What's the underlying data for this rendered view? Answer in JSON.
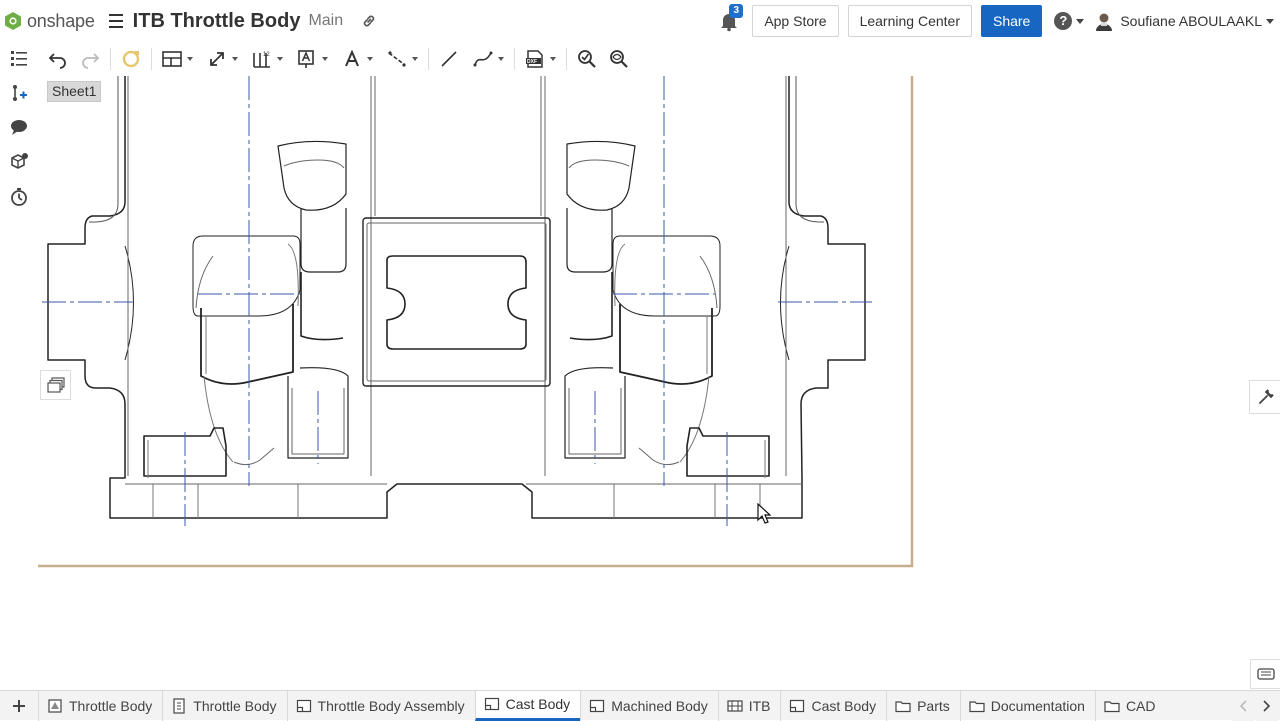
{
  "app": {
    "name": "onshape"
  },
  "document": {
    "title": "ITB Throttle Body",
    "branch": "Main"
  },
  "notifications": {
    "count": "3"
  },
  "header": {
    "app_store": "App Store",
    "learning_center": "Learning Center",
    "share": "Share",
    "user_name": "Soufiane ABOULAAKL"
  },
  "sheet": {
    "name": "Sheet1"
  },
  "colors": {
    "accent": "#1767c2",
    "sheet_border": "#c8ad8a",
    "centerline": "#3a5aa8"
  },
  "toolbar": {
    "icons": [
      "undo-icon",
      "redo-icon",
      "update-icon",
      "view-icon",
      "dimension-icon",
      "hole-table-icon",
      "note-icon",
      "text-icon",
      "centerline-icon",
      "line-icon",
      "spline-icon",
      "dxf-export-icon",
      "measure-icon",
      "zoom-icon"
    ]
  },
  "tabs": [
    {
      "label": "Throttle Body",
      "icon": "part-studio-icon",
      "active": false
    },
    {
      "label": "Throttle Body",
      "icon": "variable-studio-icon",
      "active": false
    },
    {
      "label": "Throttle Body Assembly",
      "icon": "drawing-icon",
      "active": false
    },
    {
      "label": "Cast Body",
      "icon": "drawing-icon",
      "active": true
    },
    {
      "label": "Machined Body",
      "icon": "drawing-icon",
      "active": false
    },
    {
      "label": "ITB",
      "icon": "assembly-icon",
      "active": false
    },
    {
      "label": "Cast Body",
      "icon": "drawing-icon",
      "active": false
    },
    {
      "label": "Parts",
      "icon": "folder-icon",
      "active": false
    },
    {
      "label": "Documentation",
      "icon": "folder-icon",
      "active": false
    },
    {
      "label": "CAD",
      "icon": "folder-icon",
      "active": false
    }
  ]
}
